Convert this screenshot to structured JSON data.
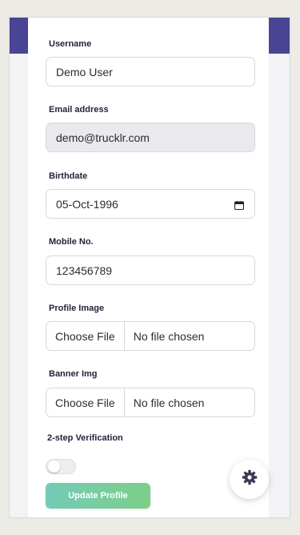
{
  "form": {
    "username_label": "Username",
    "username_value": "Demo User",
    "email_label": "Email address",
    "email_value": "demo@trucklr.com",
    "birthdate_label": "Birthdate",
    "birthdate_value": "05-Oct-1996",
    "mobile_label": "Mobile No.",
    "mobile_value": "123456789",
    "profile_image_label": "Profile Image",
    "profile_image_button": "Choose File",
    "profile_image_status": "No file chosen",
    "banner_label": "Banner Img",
    "banner_button": "Choose File",
    "banner_status": "No file chosen",
    "two_step_label": "2-step Verification",
    "two_step_enabled": false,
    "submit_label": "Update Profile"
  },
  "icons": {
    "calendar": "calendar-icon",
    "settings": "gear-icon"
  },
  "colors": {
    "header": "#4a4494",
    "submit_gradient_start": "#74cab8",
    "submit_gradient_end": "#7dcf88",
    "gear": "#3a3b57"
  }
}
